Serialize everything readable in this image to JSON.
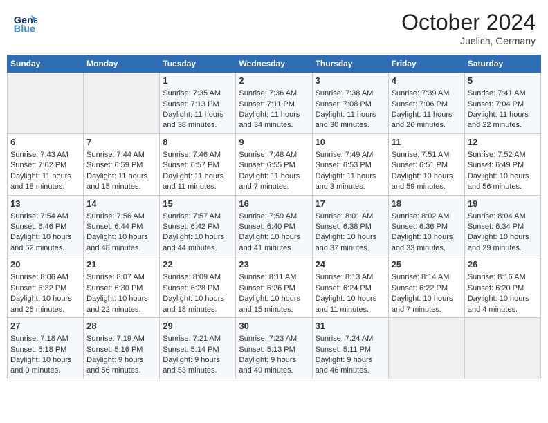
{
  "header": {
    "logo_line1": "General",
    "logo_line2": "Blue",
    "month_title": "October 2024",
    "subtitle": "Juelich, Germany"
  },
  "days_of_week": [
    "Sunday",
    "Monday",
    "Tuesday",
    "Wednesday",
    "Thursday",
    "Friday",
    "Saturday"
  ],
  "weeks": [
    [
      {
        "day": "",
        "info": ""
      },
      {
        "day": "",
        "info": ""
      },
      {
        "day": "1",
        "info": "Sunrise: 7:35 AM\nSunset: 7:13 PM\nDaylight: 11 hours and 38 minutes."
      },
      {
        "day": "2",
        "info": "Sunrise: 7:36 AM\nSunset: 7:11 PM\nDaylight: 11 hours and 34 minutes."
      },
      {
        "day": "3",
        "info": "Sunrise: 7:38 AM\nSunset: 7:08 PM\nDaylight: 11 hours and 30 minutes."
      },
      {
        "day": "4",
        "info": "Sunrise: 7:39 AM\nSunset: 7:06 PM\nDaylight: 11 hours and 26 minutes."
      },
      {
        "day": "5",
        "info": "Sunrise: 7:41 AM\nSunset: 7:04 PM\nDaylight: 11 hours and 22 minutes."
      }
    ],
    [
      {
        "day": "6",
        "info": "Sunrise: 7:43 AM\nSunset: 7:02 PM\nDaylight: 11 hours and 18 minutes."
      },
      {
        "day": "7",
        "info": "Sunrise: 7:44 AM\nSunset: 6:59 PM\nDaylight: 11 hours and 15 minutes."
      },
      {
        "day": "8",
        "info": "Sunrise: 7:46 AM\nSunset: 6:57 PM\nDaylight: 11 hours and 11 minutes."
      },
      {
        "day": "9",
        "info": "Sunrise: 7:48 AM\nSunset: 6:55 PM\nDaylight: 11 hours and 7 minutes."
      },
      {
        "day": "10",
        "info": "Sunrise: 7:49 AM\nSunset: 6:53 PM\nDaylight: 11 hours and 3 minutes."
      },
      {
        "day": "11",
        "info": "Sunrise: 7:51 AM\nSunset: 6:51 PM\nDaylight: 10 hours and 59 minutes."
      },
      {
        "day": "12",
        "info": "Sunrise: 7:52 AM\nSunset: 6:49 PM\nDaylight: 10 hours and 56 minutes."
      }
    ],
    [
      {
        "day": "13",
        "info": "Sunrise: 7:54 AM\nSunset: 6:46 PM\nDaylight: 10 hours and 52 minutes."
      },
      {
        "day": "14",
        "info": "Sunrise: 7:56 AM\nSunset: 6:44 PM\nDaylight: 10 hours and 48 minutes."
      },
      {
        "day": "15",
        "info": "Sunrise: 7:57 AM\nSunset: 6:42 PM\nDaylight: 10 hours and 44 minutes."
      },
      {
        "day": "16",
        "info": "Sunrise: 7:59 AM\nSunset: 6:40 PM\nDaylight: 10 hours and 41 minutes."
      },
      {
        "day": "17",
        "info": "Sunrise: 8:01 AM\nSunset: 6:38 PM\nDaylight: 10 hours and 37 minutes."
      },
      {
        "day": "18",
        "info": "Sunrise: 8:02 AM\nSunset: 6:36 PM\nDaylight: 10 hours and 33 minutes."
      },
      {
        "day": "19",
        "info": "Sunrise: 8:04 AM\nSunset: 6:34 PM\nDaylight: 10 hours and 29 minutes."
      }
    ],
    [
      {
        "day": "20",
        "info": "Sunrise: 8:06 AM\nSunset: 6:32 PM\nDaylight: 10 hours and 26 minutes."
      },
      {
        "day": "21",
        "info": "Sunrise: 8:07 AM\nSunset: 6:30 PM\nDaylight: 10 hours and 22 minutes."
      },
      {
        "day": "22",
        "info": "Sunrise: 8:09 AM\nSunset: 6:28 PM\nDaylight: 10 hours and 18 minutes."
      },
      {
        "day": "23",
        "info": "Sunrise: 8:11 AM\nSunset: 6:26 PM\nDaylight: 10 hours and 15 minutes."
      },
      {
        "day": "24",
        "info": "Sunrise: 8:13 AM\nSunset: 6:24 PM\nDaylight: 10 hours and 11 minutes."
      },
      {
        "day": "25",
        "info": "Sunrise: 8:14 AM\nSunset: 6:22 PM\nDaylight: 10 hours and 7 minutes."
      },
      {
        "day": "26",
        "info": "Sunrise: 8:16 AM\nSunset: 6:20 PM\nDaylight: 10 hours and 4 minutes."
      }
    ],
    [
      {
        "day": "27",
        "info": "Sunrise: 7:18 AM\nSunset: 5:18 PM\nDaylight: 10 hours and 0 minutes."
      },
      {
        "day": "28",
        "info": "Sunrise: 7:19 AM\nSunset: 5:16 PM\nDaylight: 9 hours and 56 minutes."
      },
      {
        "day": "29",
        "info": "Sunrise: 7:21 AM\nSunset: 5:14 PM\nDaylight: 9 hours and 53 minutes."
      },
      {
        "day": "30",
        "info": "Sunrise: 7:23 AM\nSunset: 5:13 PM\nDaylight: 9 hours and 49 minutes."
      },
      {
        "day": "31",
        "info": "Sunrise: 7:24 AM\nSunset: 5:11 PM\nDaylight: 9 hours and 46 minutes."
      },
      {
        "day": "",
        "info": ""
      },
      {
        "day": "",
        "info": ""
      }
    ]
  ]
}
